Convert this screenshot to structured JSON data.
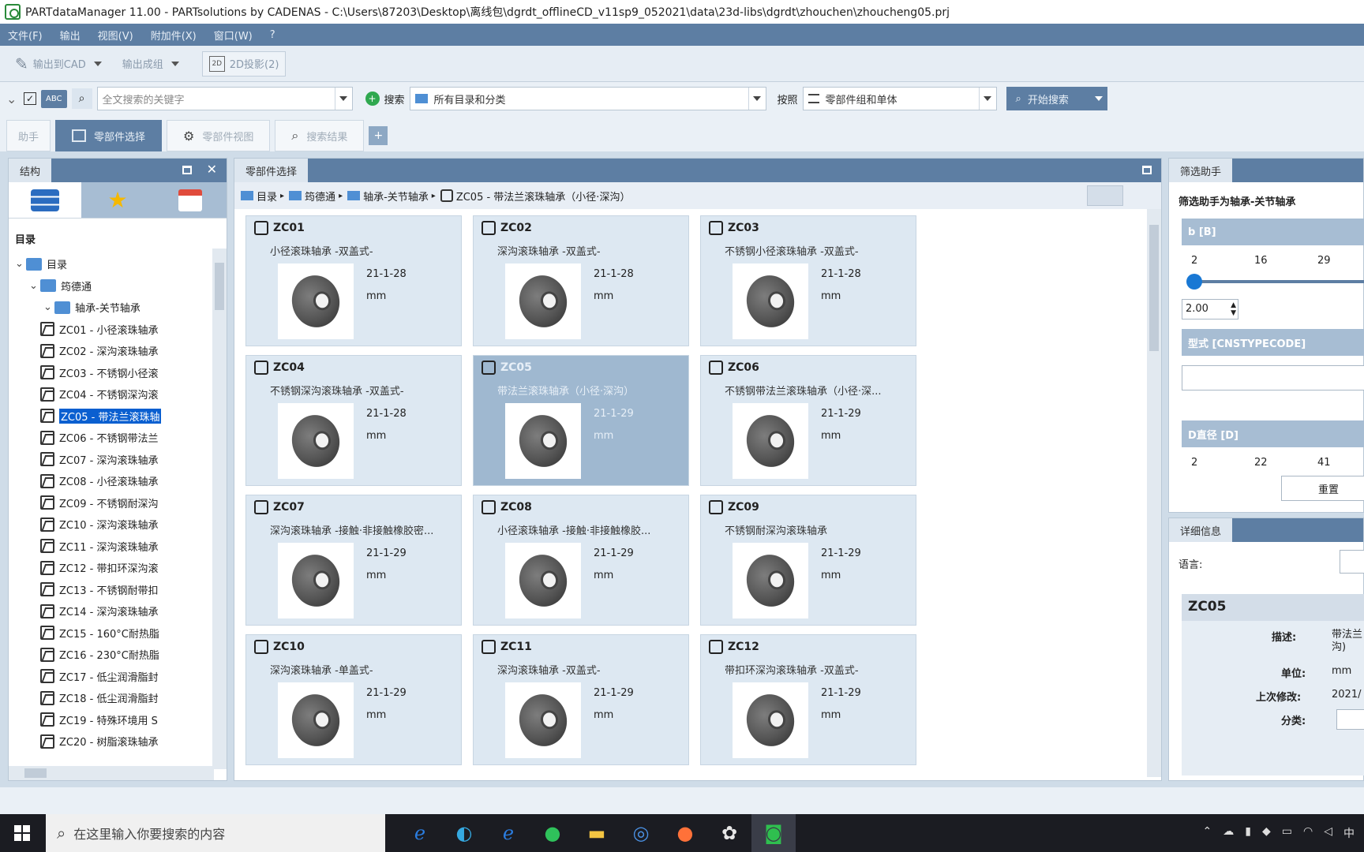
{
  "window": {
    "title": "PARTdataManager 11.00 - PARTsolutions by CADENAS - C:\\Users\\87203\\Desktop\\离线包\\dgrdt_offlineCD_v11sp9_052021\\data\\23d-libs\\dgrdt\\zhouchen\\zhoucheng05.prj"
  },
  "menu": [
    "文件(F)",
    "输出",
    "视图(V)",
    "附加件(X)",
    "窗口(W)",
    "?"
  ],
  "toolbar": {
    "export_cad": "输出到CAD",
    "export_results": "输出成组",
    "view2d": "2D投影(2)"
  },
  "search": {
    "placeholder": "全文搜索的关键字",
    "search_label": "搜索",
    "scope": "所有目录和分类",
    "by_label": "按照",
    "mode": "零部件组和单体",
    "start_label": "开始搜索",
    "abc": "ABC"
  },
  "tabs": [
    "助手",
    "零部件选择",
    "零部件视图",
    "搜索结果"
  ],
  "left_panel": {
    "tab": "结构",
    "catalog_heading": "目录",
    "tree": [
      {
        "label": "目录",
        "level": 0,
        "type": "folder"
      },
      {
        "label": "筠德通",
        "level": 1,
        "type": "folder"
      },
      {
        "label": "轴承-关节轴承",
        "level": 2,
        "type": "folder"
      },
      {
        "label": "ZC01 - 小径滚珠轴承",
        "level": 3
      },
      {
        "label": "ZC02 - 深沟滚珠轴承",
        "level": 3
      },
      {
        "label": "ZC03 - 不锈钢小径滚",
        "level": 3
      },
      {
        "label": "ZC04 - 不锈钢深沟滚",
        "level": 3
      },
      {
        "label": "ZC05 - 带法兰滚珠轴",
        "level": 3,
        "selected": true
      },
      {
        "label": "ZC06 - 不锈钢带法兰",
        "level": 3
      },
      {
        "label": "ZC07 - 深沟滚珠轴承",
        "level": 3
      },
      {
        "label": "ZC08 - 小径滚珠轴承",
        "level": 3
      },
      {
        "label": "ZC09 - 不锈钢耐深沟",
        "level": 3
      },
      {
        "label": "ZC10 - 深沟滚珠轴承",
        "level": 3
      },
      {
        "label": "ZC11 - 深沟滚珠轴承",
        "level": 3
      },
      {
        "label": "ZC12 - 带扣环深沟滚",
        "level": 3
      },
      {
        "label": "ZC13 - 不锈钢耐带扣",
        "level": 3
      },
      {
        "label": "ZC14 - 深沟滚珠轴承",
        "level": 3
      },
      {
        "label": "ZC15 - 160°C耐热脂",
        "level": 3
      },
      {
        "label": "ZC16 - 230°C耐热脂",
        "level": 3
      },
      {
        "label": "ZC17 - 低尘润滑脂封",
        "level": 3
      },
      {
        "label": "ZC18 - 低尘润滑脂封",
        "level": 3
      },
      {
        "label": "ZC19 - 特殊环境用 S",
        "level": 3
      },
      {
        "label": "ZC20 - 树脂滚珠轴承",
        "level": 3
      }
    ]
  },
  "center_panel": {
    "tab": "零部件选择",
    "breadcrumb": [
      "目录",
      "筠德通",
      "轴承-关节轴承",
      "ZC05 - 带法兰滚珠轴承（小径·深沟）"
    ],
    "cards": [
      {
        "id": "ZC01",
        "desc": "小径滚珠轴承 -双盖式-",
        "date": "21-1-28",
        "unit": "mm"
      },
      {
        "id": "ZC02",
        "desc": "深沟滚珠轴承 -双盖式-",
        "date": "21-1-28",
        "unit": "mm"
      },
      {
        "id": "ZC03",
        "desc": "不锈钢小径滚珠轴承 -双盖式-",
        "date": "21-1-28",
        "unit": "mm"
      },
      {
        "id": "ZC04",
        "desc": "不锈钢深沟滚珠轴承 -双盖式-",
        "date": "21-1-28",
        "unit": "mm"
      },
      {
        "id": "ZC05",
        "desc": "带法兰滚珠轴承（小径·深沟）",
        "date": "21-1-29",
        "unit": "mm",
        "selected": true
      },
      {
        "id": "ZC06",
        "desc": "不锈钢带法兰滚珠轴承（小径·深...",
        "date": "21-1-29",
        "unit": "mm"
      },
      {
        "id": "ZC07",
        "desc": "深沟滚珠轴承 -接触·非接触橡胶密...",
        "date": "21-1-29",
        "unit": "mm"
      },
      {
        "id": "ZC08",
        "desc": "小径滚珠轴承 -接触·非接触橡胶...",
        "date": "21-1-29",
        "unit": "mm"
      },
      {
        "id": "ZC09",
        "desc": "不锈钢耐深沟滚珠轴承",
        "date": "21-1-29",
        "unit": "mm"
      },
      {
        "id": "ZC10",
        "desc": "深沟滚珠轴承 -单盖式-",
        "date": "21-1-29",
        "unit": "mm"
      },
      {
        "id": "ZC11",
        "desc": "深沟滚珠轴承 -双盖式-",
        "date": "21-1-29",
        "unit": "mm"
      },
      {
        "id": "ZC12",
        "desc": "带扣环深沟滚珠轴承 -双盖式-",
        "date": "21-1-29",
        "unit": "mm"
      }
    ]
  },
  "filter_panel": {
    "tab": "筛选助手",
    "title": "筛选助手为轴承-关节轴承",
    "b_label": "b [B]",
    "b_ticks": [
      "2",
      "16",
      "29"
    ],
    "b_value": "2.00",
    "type_label": "型式 [CNSTYPECODE]",
    "d_label": "D直径 [D]",
    "d_ticks": [
      "2",
      "22",
      "41"
    ],
    "reset": "重置"
  },
  "detail_panel": {
    "tab": "详细信息",
    "lang_label": "语言:",
    "part_id": "ZC05",
    "desc_label": "描述:",
    "desc_value": "带法兰\n沟)",
    "unit_label": "单位:",
    "unit_value": "mm",
    "modified_label": "上次修改:",
    "modified_value": "2021/",
    "class_label": "分类:"
  },
  "taskbar": {
    "search_placeholder": "在这里输入你要搜索的内容",
    "clock": "中"
  }
}
